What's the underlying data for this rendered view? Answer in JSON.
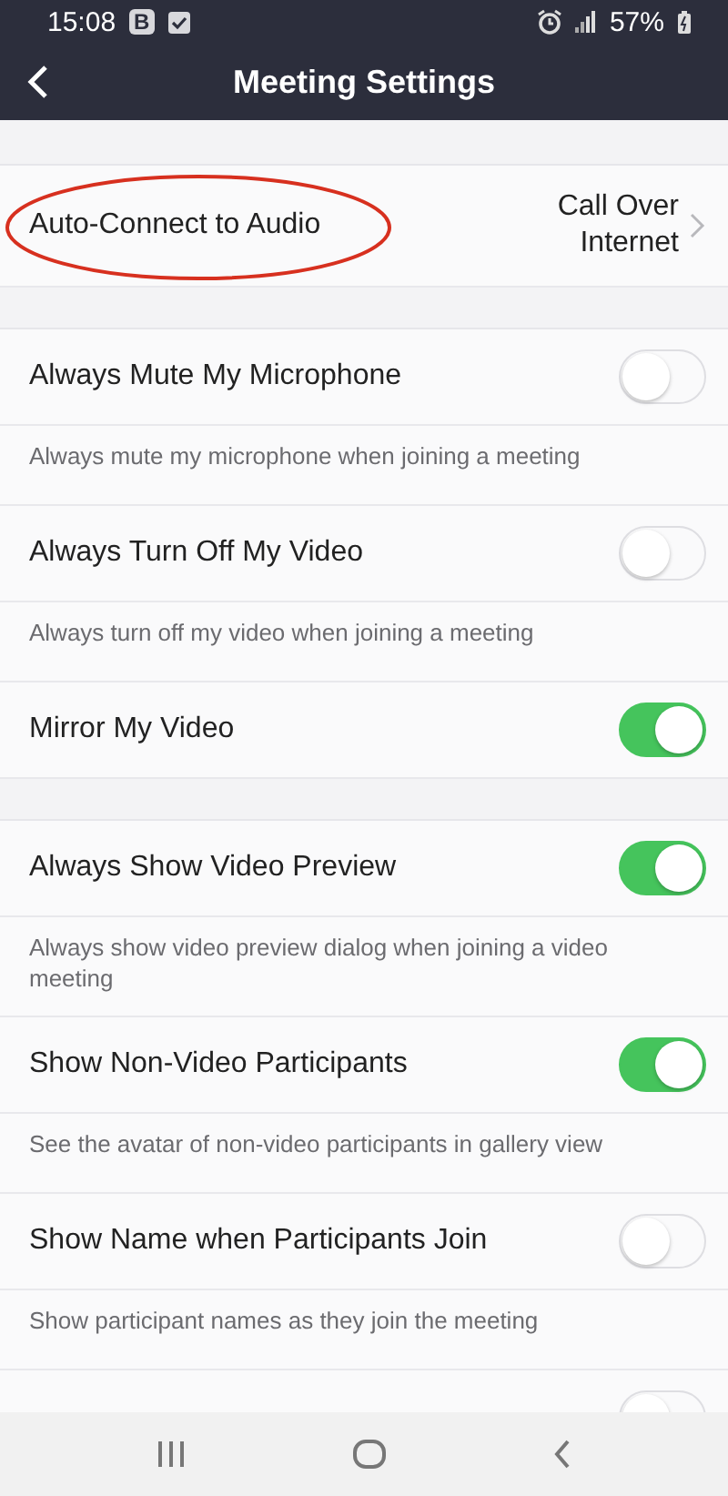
{
  "status_bar": {
    "time": "15:08",
    "badge": "B",
    "battery": "57%"
  },
  "header": {
    "title": "Meeting Settings"
  },
  "sections": [
    {
      "items": [
        {
          "kind": "link",
          "title": "Auto-Connect to Audio",
          "value": "Call Over Internet",
          "circled": true
        }
      ]
    },
    {
      "items": [
        {
          "kind": "toggle",
          "title": "Always Mute My Microphone",
          "on": false,
          "description": "Always mute my microphone when joining a meeting"
        },
        {
          "kind": "toggle",
          "title": "Always Turn Off My Video",
          "on": false,
          "description": "Always turn off my video when joining a meeting"
        },
        {
          "kind": "toggle",
          "title": "Mirror My Video",
          "on": true
        }
      ]
    },
    {
      "items": [
        {
          "kind": "toggle",
          "title": "Always Show Video Preview",
          "on": true,
          "description": "Always show video preview dialog when joining a video meeting"
        },
        {
          "kind": "toggle",
          "title": "Show Non-Video Participants",
          "on": true,
          "description": "See the avatar of non-video participants in gallery view"
        },
        {
          "kind": "toggle",
          "title": "Show Name when Participants Join",
          "on": false,
          "description": "Show participant names as they join the meeting"
        },
        {
          "kind": "toggle",
          "on": false
        }
      ]
    }
  ]
}
